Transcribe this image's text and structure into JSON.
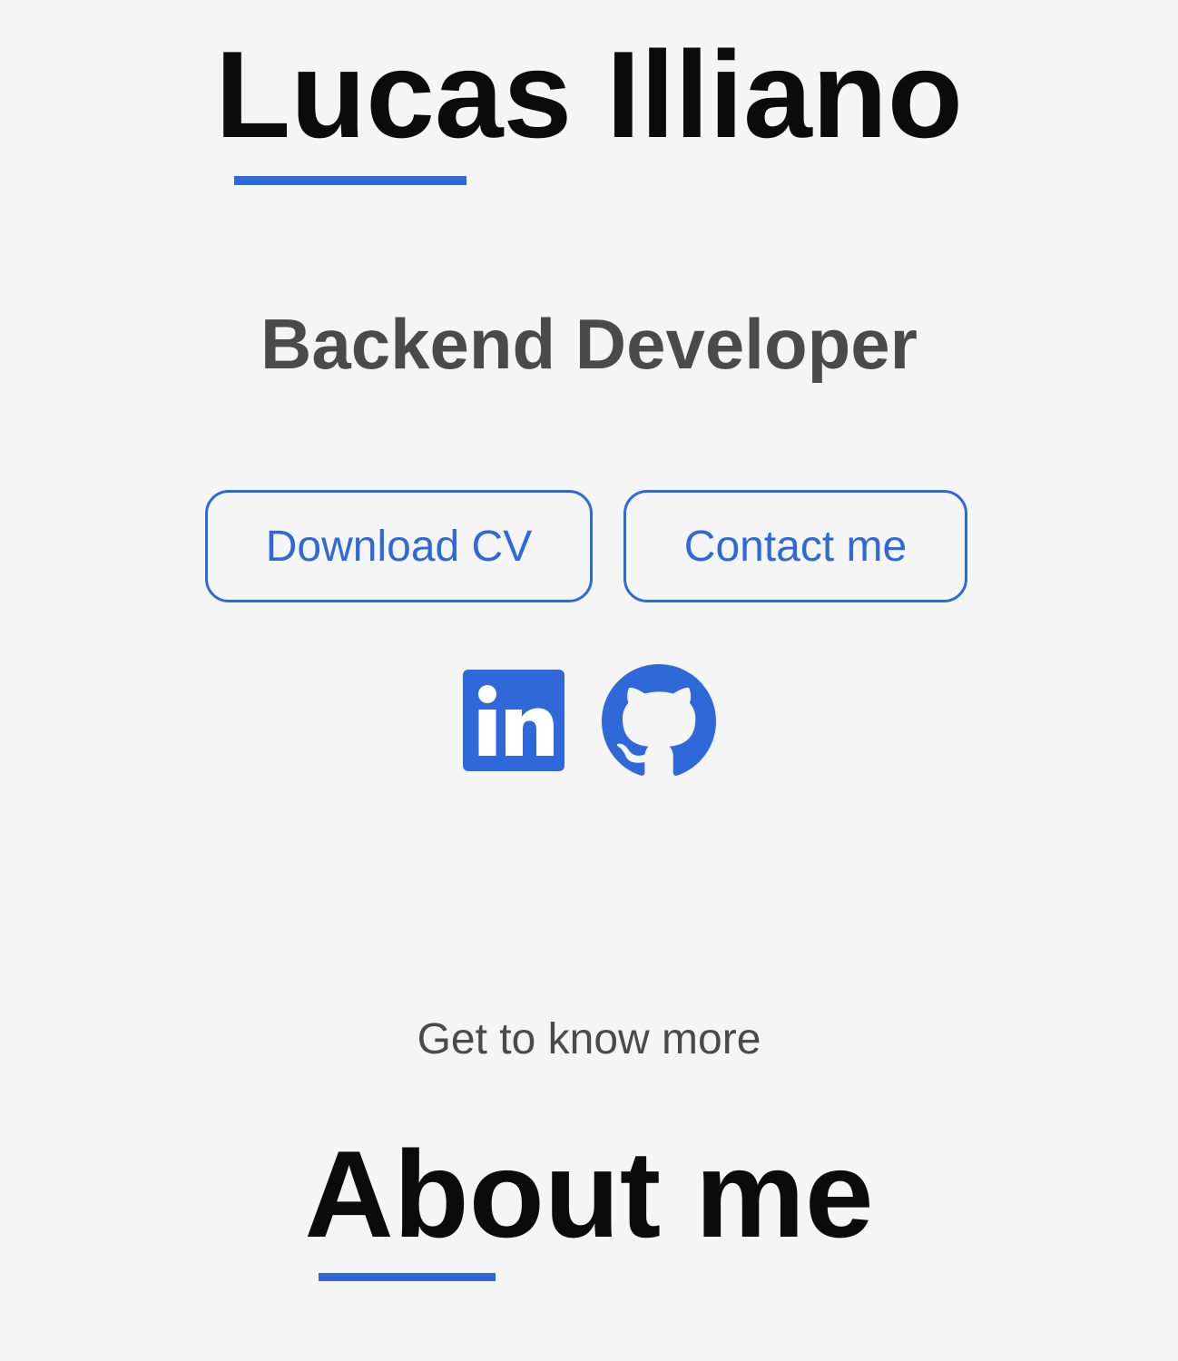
{
  "profile": {
    "name": "Lucas Illiano",
    "role": "Backend Developer"
  },
  "actions": {
    "download_cv": "Download CV",
    "contact": "Contact me"
  },
  "social": {
    "linkedin_icon": "linkedin-icon",
    "github_icon": "github-icon"
  },
  "about": {
    "kicker": "Get to know more",
    "title": "About me"
  },
  "colors": {
    "accent": "#2f69d9",
    "background": "#f5f5f5",
    "heading": "#0b0b0b",
    "subtext": "#4a4a4a"
  }
}
